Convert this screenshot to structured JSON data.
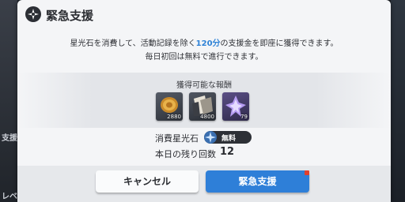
{
  "background": {
    "left_fragments": [
      "支援",
      "レベ"
    ]
  },
  "dialog": {
    "title": "緊急支援",
    "desc_line1_pre": "星光石を消費して、活動記録を除く",
    "desc_line1_highlight": "120分",
    "desc_line1_post": "の支援金を即座に獲得できます。",
    "desc_line2": "毎日初回は無料で進行できます。",
    "rewards_title": "獲得可能な報酬",
    "rewards": [
      {
        "icon": "gold-coin-icon",
        "qty": "2880"
      },
      {
        "icon": "data-shard-icon",
        "qty": "4800"
      },
      {
        "icon": "purple-crystal-icon",
        "qty": "79"
      }
    ],
    "cost_label": "消費星光石",
    "cost_value": "無料",
    "remaining_label": "本日の残り回数",
    "remaining_value": "12",
    "cancel_label": "キャンセル",
    "confirm_label": "緊急支援"
  },
  "colors": {
    "accent": "#2e7fd8",
    "highlight": "#2e82d6",
    "badge": "#e0402e"
  }
}
